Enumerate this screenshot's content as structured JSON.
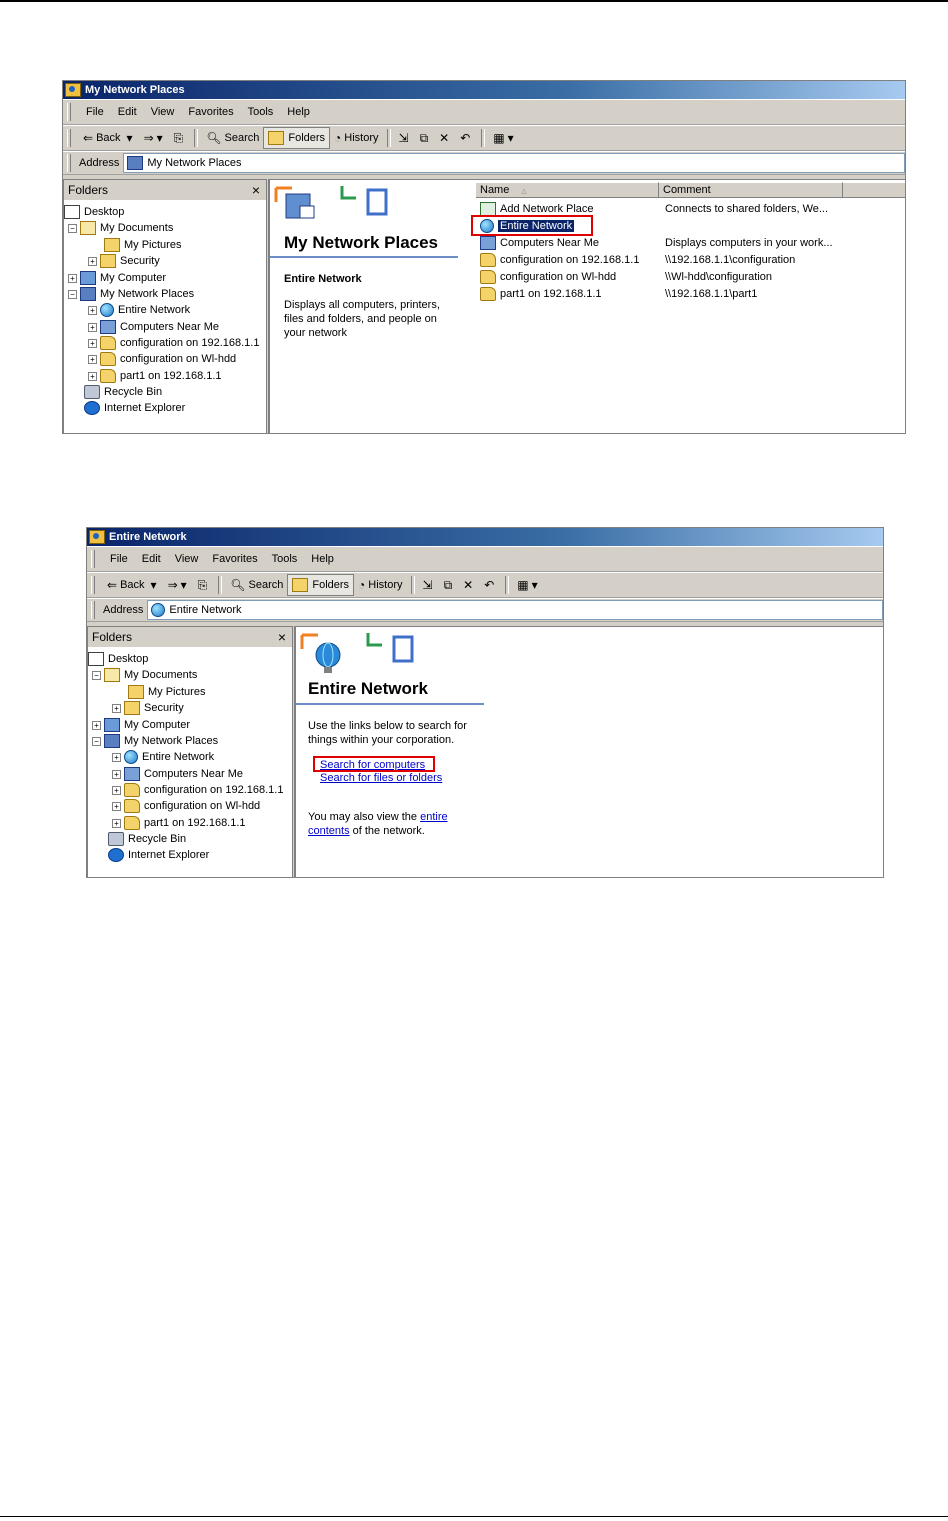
{
  "win1": {
    "title": "My Network Places",
    "menu": [
      "File",
      "Edit",
      "View",
      "Favorites",
      "Tools",
      "Help"
    ],
    "toolbar": {
      "back": "Back",
      "search": "Search",
      "folders": "Folders",
      "history": "History"
    },
    "address_label": "Address",
    "address_value": "My Network Places",
    "folders_title": "Folders",
    "close": "×",
    "tree": [
      "Desktop",
      "My Documents",
      "My Pictures",
      "Security",
      "My Computer",
      "My Network Places",
      "Entire Network",
      "Computers Near Me",
      "configuration on 192.168.1.1",
      "configuration on Wl-hdd",
      "part1 on 192.168.1.1",
      "Recycle Bin",
      "Internet Explorer"
    ],
    "web_title": "My Network Places",
    "web_subtitle": "Entire Network",
    "web_desc_1": "Displays all computers, printers,",
    "web_desc_2": "files and folders, and people on",
    "web_desc_3": "your network",
    "col_name": "Name",
    "col_comment": "Comment",
    "rows": [
      {
        "name": "Add Network Place",
        "comment": "Connects to shared folders, We..."
      },
      {
        "name": "Entire Network",
        "comment": ""
      },
      {
        "name": "Computers Near Me",
        "comment": "Displays computers in your work..."
      },
      {
        "name": "configuration on 192.168.1.1",
        "comment": "\\\\192.168.1.1\\configuration"
      },
      {
        "name": "configuration on Wl-hdd",
        "comment": "\\\\Wl-hdd\\configuration"
      },
      {
        "name": "part1 on 192.168.1.1",
        "comment": "\\\\192.168.1.1\\part1"
      }
    ]
  },
  "win2": {
    "title": "Entire Network",
    "menu": [
      "File",
      "Edit",
      "View",
      "Favorites",
      "Tools",
      "Help"
    ],
    "toolbar": {
      "back": "Back",
      "search": "Search",
      "folders": "Folders",
      "history": "History"
    },
    "address_label": "Address",
    "address_value": "Entire Network",
    "folders_title": "Folders",
    "close": "×",
    "tree": [
      "Desktop",
      "My Documents",
      "My Pictures",
      "Security",
      "My Computer",
      "My Network Places",
      "Entire Network",
      "Computers Near Me",
      "configuration on 192.168.1.1",
      "configuration on Wl-hdd",
      "part1 on 192.168.1.1",
      "Recycle Bin",
      "Internet Explorer"
    ],
    "web_title": "Entire Network",
    "text_1": "Use the links below to search for",
    "text_2": "things within your corporation.",
    "link_computers": "Search for computers",
    "link_files": "Search for files or folders",
    "view_pre": "You may also view the ",
    "view_link_1": "entire",
    "view_link_2": "contents",
    "view_post": " of the network."
  }
}
